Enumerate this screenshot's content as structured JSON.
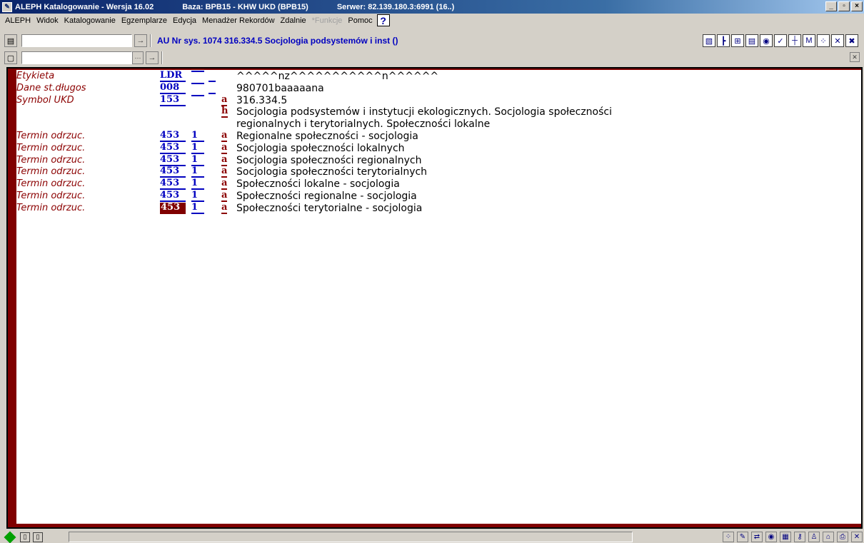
{
  "title": {
    "app": "ALEPH Katalogowanie - Wersja 16.02",
    "base": "Baza: BPB15 - KHW UKD (BPB15)",
    "server": "Serwer: 82.139.180.3:6991 (16..)"
  },
  "window_controls": {
    "minimize": "_",
    "maximize": "▫",
    "close": "×"
  },
  "menu": [
    "ALEPH",
    "Widok",
    "Katalogowanie",
    "Egzemplarze",
    "Edycja",
    "Menadżer Rekordów",
    "Zdalnie",
    "*Funkcje",
    "Pomoc"
  ],
  "help_label": "?",
  "toolbar": {
    "record_title": "AU Nr sys. 1074 316.334.5 Socjologia podsystemów i inst ()",
    "go_glyph": "→",
    "dots_glyph": "···"
  },
  "icons": [
    "list-icon",
    "tree-icon",
    "grid-icon",
    "form-icon",
    "globe-icon",
    "check-icon",
    "tag-icon",
    "m-icon",
    "dots-icon",
    "x-icon",
    "x2-icon"
  ],
  "record": [
    {
      "label": "Etykieta",
      "tag": "LDR",
      "ind1": "",
      "ind2": "",
      "sub": "",
      "value": "^^^^^nz^^^^^^^^^^^n^^^^^^"
    },
    {
      "label": "Dane st.długos",
      "tag": "008",
      "ind1": "",
      "ind2": "",
      "sub": "",
      "value": "980701baaaaana"
    },
    {
      "label": "Symbol UKD",
      "tag": "153",
      "ind1": "",
      "ind2": "",
      "sub": "a",
      "value": "316.334.5"
    },
    {
      "label": "",
      "tag": "",
      "ind1": "",
      "ind2": "",
      "sub": "h",
      "value": "Socjologia podsystemów i instytucji ekologicznych. Socjologia społeczności"
    },
    {
      "label": "",
      "tag": "",
      "ind1": "",
      "ind2": "",
      "sub": "",
      "value": "regionalnych i terytorialnych. Społeczności lokalne"
    },
    {
      "label": "Termin odrzuc.",
      "tag": "453",
      "ind1": "1",
      "ind2": "",
      "sub": "a",
      "value": "Regionalne społeczności - socjologia"
    },
    {
      "label": "Termin odrzuc.",
      "tag": "453",
      "ind1": "1",
      "ind2": "",
      "sub": "a",
      "value": "Socjologia społeczności lokalnych"
    },
    {
      "label": "Termin odrzuc.",
      "tag": "453",
      "ind1": "1",
      "ind2": "",
      "sub": "a",
      "value": "Socjologia społeczności regionalnych"
    },
    {
      "label": "Termin odrzuc.",
      "tag": "453",
      "ind1": "1",
      "ind2": "",
      "sub": "a",
      "value": "Socjologia społeczności terytorialnych"
    },
    {
      "label": "Termin odrzuc.",
      "tag": "453",
      "ind1": "1",
      "ind2": "",
      "sub": "a",
      "value": "Społeczności lokalne - socjologia"
    },
    {
      "label": "Termin odrzuc.",
      "tag": "453",
      "ind1": "1",
      "ind2": "",
      "sub": "a",
      "value": "Społeczności regionalne - socjologia"
    },
    {
      "label": "Termin odrzuc.",
      "tag": "453",
      "ind1": "1",
      "ind2": "",
      "sub": "a",
      "value": "Społeczności terytorialne - socjologia"
    }
  ],
  "selected_row": 11,
  "colors": {
    "label": "#8b0000",
    "tag": "#0000c0",
    "selection": "#800000",
    "title_bar": "#0a246a"
  }
}
